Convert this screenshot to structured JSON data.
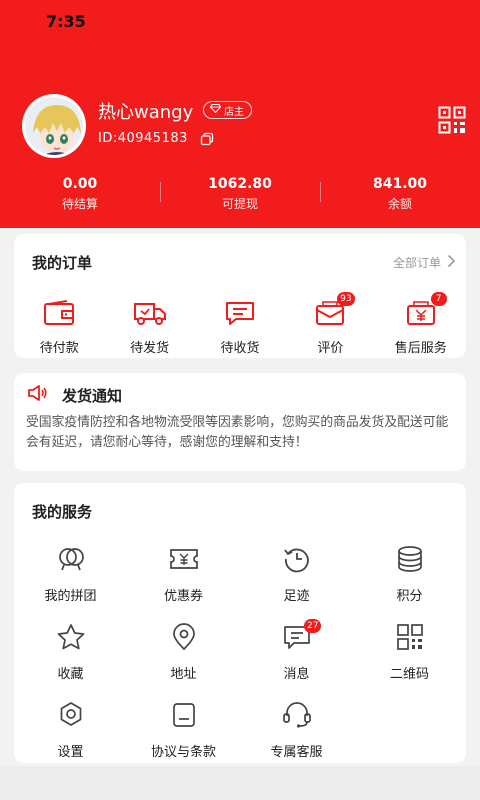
{
  "status_bar": {
    "time": "7:35"
  },
  "colors": {
    "brand": "#f21c1c",
    "badge": "#f21c1c",
    "background": "#f2f2f2"
  },
  "profile": {
    "nickname": "热心wangy",
    "role_badge": "店主",
    "uid_text": "ID:40945183"
  },
  "stats": [
    {
      "value": "0.00",
      "label": "待结算"
    },
    {
      "value": "1062.80",
      "label": "可提现"
    },
    {
      "value": "841.00",
      "label": "余额"
    }
  ],
  "orders": {
    "title": "我的订单",
    "all_link": "全部订单",
    "items": [
      {
        "label": "待付款",
        "icon": "wallet-icon",
        "badge": ""
      },
      {
        "label": "待发货",
        "icon": "truck-icon",
        "badge": ""
      },
      {
        "label": "待收货",
        "icon": "chat-box-icon",
        "badge": ""
      },
      {
        "label": "评价",
        "icon": "envelope-icon",
        "badge": "93"
      },
      {
        "label": "售后服务",
        "icon": "refund-icon",
        "badge": "7"
      }
    ]
  },
  "notice": {
    "title": "发货通知",
    "body": "受国家疫情防控和各地物流受限等因素影响，您购买的商品发货及配送可能会有延迟，请您耐心等待，感谢您的理解和支持！"
  },
  "services": {
    "title": "我的服务",
    "items": [
      {
        "label": "我的拼团",
        "icon": "group-icon",
        "badge": ""
      },
      {
        "label": "优惠券",
        "icon": "coupon-icon",
        "badge": ""
      },
      {
        "label": "足迹",
        "icon": "history-icon",
        "badge": ""
      },
      {
        "label": "积分",
        "icon": "coins-icon",
        "badge": ""
      },
      {
        "label": "收藏",
        "icon": "star-icon",
        "badge": ""
      },
      {
        "label": "地址",
        "icon": "location-icon",
        "badge": ""
      },
      {
        "label": "消息",
        "icon": "message-icon",
        "badge": "27"
      },
      {
        "label": "二维码",
        "icon": "qrcode-icon",
        "badge": ""
      },
      {
        "label": "设置",
        "icon": "settings-icon",
        "badge": ""
      },
      {
        "label": "协议与条款",
        "icon": "document-icon",
        "badge": ""
      },
      {
        "label": "专属客服",
        "icon": "headset-icon",
        "badge": ""
      }
    ]
  }
}
